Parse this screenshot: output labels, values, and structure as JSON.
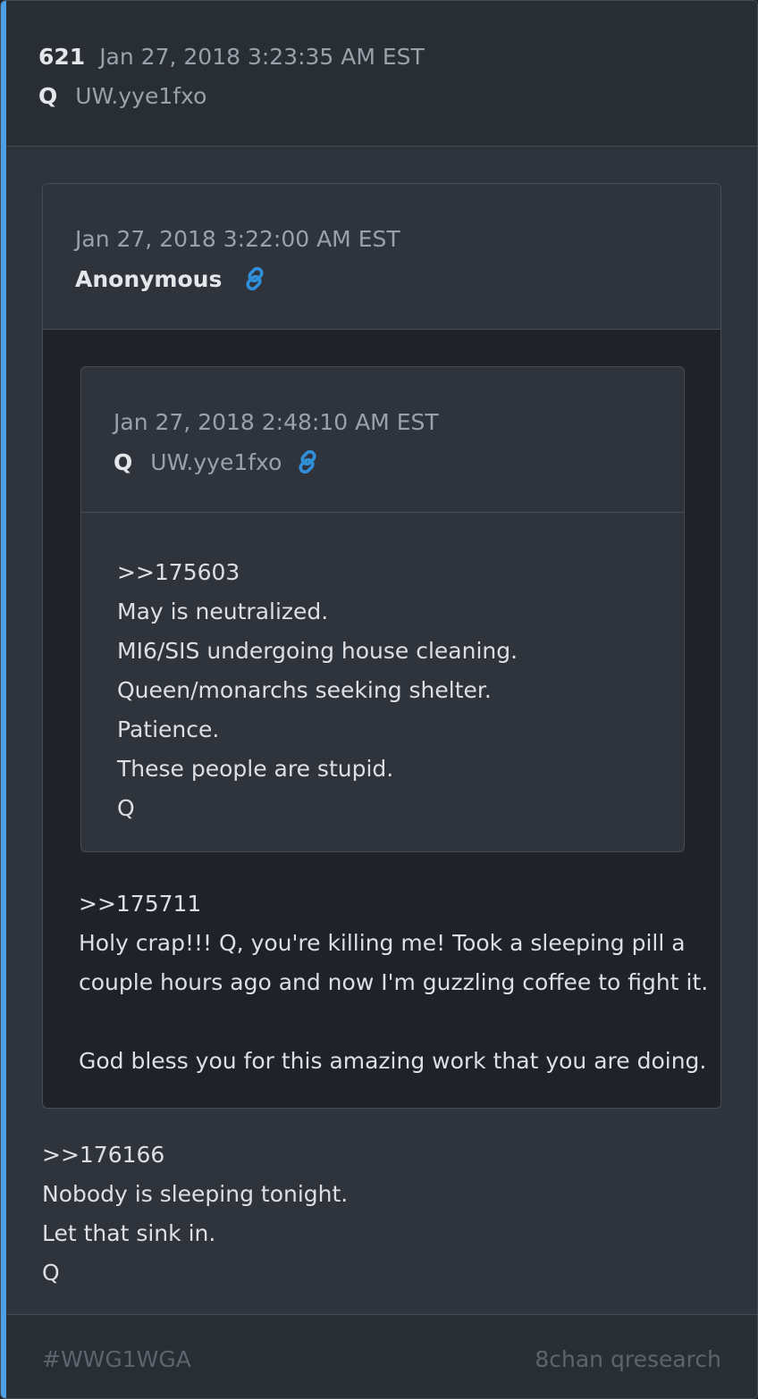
{
  "post": {
    "number": "621",
    "timestamp": "Jan 27, 2018 3:23:35 AM EST",
    "author": "Q",
    "tripcode": "UW.yye1fxo",
    "body": [
      ">>176166",
      "Nobody is sleeping tonight.",
      "Let that sink in.",
      "Q"
    ],
    "footer": {
      "hashtag": "#WWG1WGA",
      "source": "8chan qresearch"
    }
  },
  "quote1": {
    "timestamp": "Jan 27, 2018 3:22:00 AM EST",
    "author": "Anonymous",
    "link_icon": "link-icon",
    "body": [
      ">>175711",
      "Holy crap!!! Q, you're killing me! Took a sleeping pill a",
      "couple hours ago and now I'm guzzling coffee to fight it.",
      "",
      "God bless you for this amazing work that you are doing."
    ]
  },
  "quote2": {
    "timestamp": "Jan 27, 2018 2:48:10 AM EST",
    "author": "Q",
    "tripcode": "UW.yye1fxo",
    "link_icon": "link-icon",
    "body": [
      ">>175603",
      "May is neutralized.",
      "MI6/SIS undergoing house cleaning.",
      "Queen/monarchs seeking shelter.",
      "Patience.",
      "These people are stupid.",
      "Q"
    ]
  },
  "colors": {
    "accent": "#4f9fe6",
    "link": "#2f8fd8",
    "background": "#2f343c"
  }
}
